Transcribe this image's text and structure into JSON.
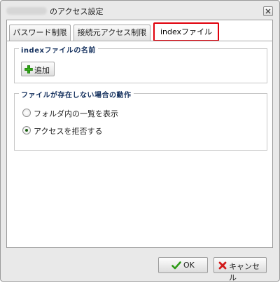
{
  "window": {
    "title_suffix": "のアクセス設定",
    "close_icon": "close-icon"
  },
  "tabs": [
    {
      "label": "パスワード制限",
      "active": false
    },
    {
      "label": "接続元アクセス制限",
      "active": false
    },
    {
      "label": "indexファイル",
      "active": true
    }
  ],
  "index_section": {
    "legend": "indexファイルの名前",
    "add_button": {
      "label": "追加",
      "icon": "plus-icon",
      "icon_color": "#2fa416"
    }
  },
  "missing_file_section": {
    "legend": "ファイルが存在しない場合の動作",
    "options": [
      {
        "label": "フォルダ内の一覧を表示",
        "selected": false
      },
      {
        "label": "アクセスを拒否する",
        "selected": true
      }
    ]
  },
  "footer": {
    "ok_button": {
      "label": "OK",
      "icon": "check-icon",
      "icon_color": "#2e9a17"
    },
    "cancel_button": {
      "label": "キャンセル",
      "icon": "x-icon",
      "icon_color": "#d21a1a"
    }
  },
  "colors": {
    "active_tab_border": "#e0000b",
    "legend_text": "#15315e"
  }
}
